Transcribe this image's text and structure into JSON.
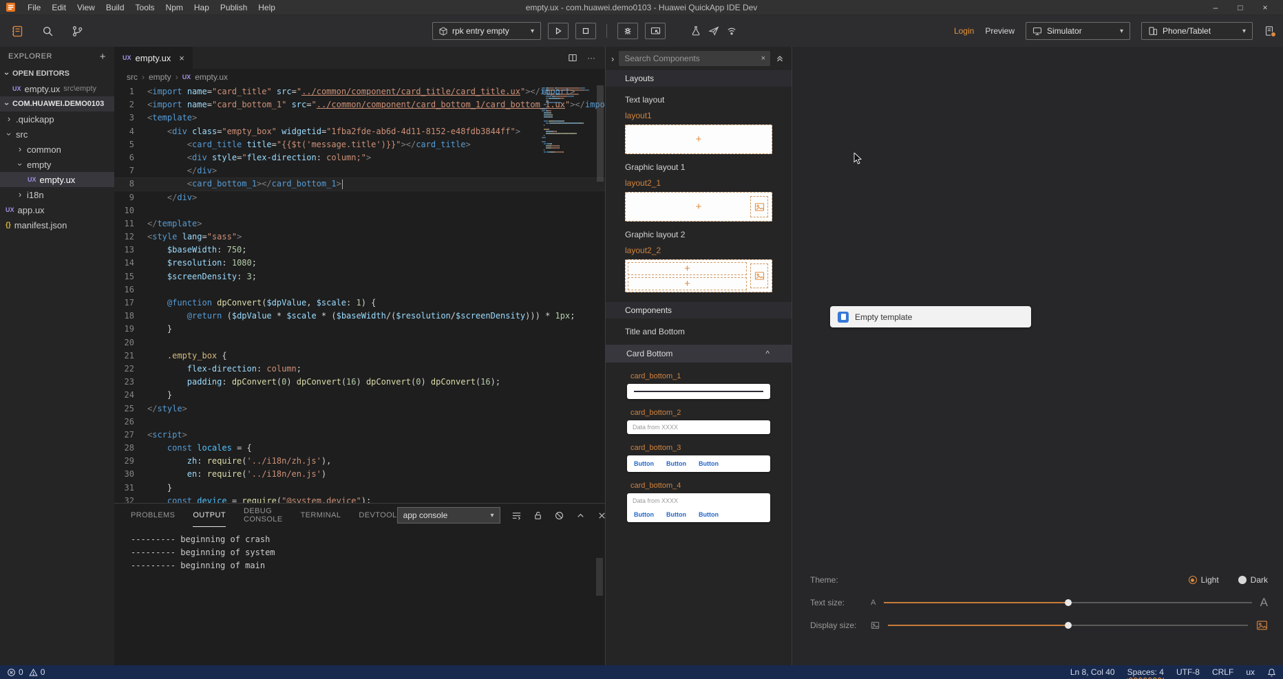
{
  "colors": {
    "accent_orange": "#e08a3c",
    "logo_orange": "#e87722",
    "card_button_blue": "#2468c8",
    "template_icon_blue": "#3678d6",
    "statusbar_navy": "#18294e"
  },
  "glyphs": {
    "plus": "+",
    "close": "×",
    "chevron_right": "›",
    "dropdown_arrow": "▾",
    "caret_up": "^",
    "ellipsis": "···",
    "minimize": "–",
    "maximize": "□",
    "ux_badge": "UX",
    "json_badge": "{}"
  },
  "title_bar": {
    "menus": [
      "File",
      "Edit",
      "View",
      "Build",
      "Tools",
      "Npm",
      "Hap",
      "Publish",
      "Help"
    ],
    "title": "empty.ux - com.huawei.demo0103 - Huawei QuickApp IDE Dev"
  },
  "toolbar": {
    "target_dropdown": "rpk entry empty",
    "login": "Login",
    "preview": "Preview",
    "simulator": "Simulator",
    "device": "Phone/Tablet"
  },
  "explorer": {
    "title": "EXPLORER",
    "open_editors_label": "OPEN EDITORS",
    "open_editor": {
      "badge": "UX",
      "file": "empty.ux",
      "path": "src\\empty"
    },
    "project_label": "COM.HUAWEI.DEMO0103",
    "items": [
      {
        "label": ".quickapp",
        "indent": 1,
        "kind": "folder",
        "expanded": false
      },
      {
        "label": "src",
        "indent": 1,
        "kind": "folder",
        "expanded": true
      },
      {
        "label": "common",
        "indent": 2,
        "kind": "folder",
        "expanded": false
      },
      {
        "label": "empty",
        "indent": 2,
        "kind": "folder",
        "expanded": true
      },
      {
        "label": "empty.ux",
        "indent": 3,
        "kind": "ux",
        "selected": true
      },
      {
        "label": "i18n",
        "indent": 2,
        "kind": "folder",
        "expanded": false
      },
      {
        "label": "app.ux",
        "indent": 1,
        "kind": "ux"
      },
      {
        "label": "manifest.json",
        "indent": 1,
        "kind": "json"
      }
    ]
  },
  "editor": {
    "tab": {
      "badge": "UX",
      "name": "empty.ux"
    },
    "breadcrumb": {
      "root": "src",
      "folder": "empty",
      "badge": "UX",
      "file": "empty.ux"
    },
    "cursor": {
      "line": 8
    },
    "code_lines": [
      [
        [
          "br",
          "<"
        ],
        [
          "tag",
          "import"
        ],
        [
          "pl",
          " "
        ],
        [
          "at",
          "name"
        ],
        [
          "pu",
          "="
        ],
        [
          "st",
          "\"card_title\""
        ],
        [
          "pl",
          " "
        ],
        [
          "at",
          "src"
        ],
        [
          "pu",
          "="
        ],
        [
          "st",
          "\""
        ],
        [
          "sl",
          "../common/component/card_title/card_title.ux"
        ],
        [
          "st",
          "\""
        ],
        [
          "br",
          "></"
        ],
        [
          "tag",
          "import"
        ],
        [
          "br",
          ">"
        ]
      ],
      [
        [
          "br",
          "<"
        ],
        [
          "tag",
          "import"
        ],
        [
          "pl",
          " "
        ],
        [
          "at",
          "name"
        ],
        [
          "pu",
          "="
        ],
        [
          "st",
          "\"card_bottom_1\""
        ],
        [
          "pl",
          " "
        ],
        [
          "at",
          "src"
        ],
        [
          "pu",
          "="
        ],
        [
          "st",
          "\""
        ],
        [
          "sl",
          "../common/component/card_bottom_1/card_bottom_1.ux"
        ],
        [
          "st",
          "\""
        ],
        [
          "br",
          "></"
        ],
        [
          "tag",
          "import"
        ],
        [
          "br",
          ">"
        ]
      ],
      [
        [
          "br",
          "<"
        ],
        [
          "tag",
          "template"
        ],
        [
          "br",
          ">"
        ]
      ],
      [
        [
          "pl",
          "    "
        ],
        [
          "br",
          "<"
        ],
        [
          "tag",
          "div"
        ],
        [
          "pl",
          " "
        ],
        [
          "at",
          "class"
        ],
        [
          "pu",
          "="
        ],
        [
          "st",
          "\"empty_box\""
        ],
        [
          "pl",
          " "
        ],
        [
          "at",
          "widgetid"
        ],
        [
          "pu",
          "="
        ],
        [
          "st",
          "\"1fba2fde-ab6d-4d11-8152-e48fdb3844ff\""
        ],
        [
          "br",
          ">"
        ]
      ],
      [
        [
          "pl",
          "        "
        ],
        [
          "br",
          "<"
        ],
        [
          "tag",
          "card_title"
        ],
        [
          "pl",
          " "
        ],
        [
          "at",
          "title"
        ],
        [
          "pu",
          "="
        ],
        [
          "st",
          "\"{{$t('message.title')}}\""
        ],
        [
          "br",
          "></"
        ],
        [
          "tag",
          "card_title"
        ],
        [
          "br",
          ">"
        ]
      ],
      [
        [
          "pl",
          "        "
        ],
        [
          "br",
          "<"
        ],
        [
          "tag",
          "div"
        ],
        [
          "pl",
          " "
        ],
        [
          "at",
          "style"
        ],
        [
          "pu",
          "="
        ],
        [
          "st",
          "\""
        ],
        [
          "pr",
          "flex-direction"
        ],
        [
          "pu",
          ": "
        ],
        [
          "vl",
          "column;"
        ],
        [
          "st",
          "\""
        ],
        [
          "br",
          ">"
        ]
      ],
      [
        [
          "pl",
          "        "
        ],
        [
          "br",
          "</"
        ],
        [
          "tag",
          "div"
        ],
        [
          "br",
          ">"
        ]
      ],
      [
        [
          "pl",
          "        "
        ],
        [
          "br",
          "<"
        ],
        [
          "tag",
          "card_bottom_1"
        ],
        [
          "br",
          "></"
        ],
        [
          "tag",
          "card_bottom_1"
        ],
        [
          "br",
          ">"
        ]
      ],
      [
        [
          "pl",
          "    "
        ],
        [
          "br",
          "</"
        ],
        [
          "tag",
          "div"
        ],
        [
          "br",
          ">"
        ]
      ],
      [],
      [
        [
          "br",
          "</"
        ],
        [
          "tag",
          "template"
        ],
        [
          "br",
          ">"
        ]
      ],
      [
        [
          "br",
          "<"
        ],
        [
          "tag",
          "style"
        ],
        [
          "pl",
          " "
        ],
        [
          "at",
          "lang"
        ],
        [
          "pu",
          "="
        ],
        [
          "st",
          "\"sass\""
        ],
        [
          "br",
          ">"
        ]
      ],
      [
        [
          "pl",
          "    "
        ],
        [
          "vr",
          "$baseWidth"
        ],
        [
          "pu",
          ": "
        ],
        [
          "nm",
          "750"
        ],
        [
          "pu",
          ";"
        ]
      ],
      [
        [
          "pl",
          "    "
        ],
        [
          "vr",
          "$resolution"
        ],
        [
          "pu",
          ": "
        ],
        [
          "nm",
          "1080"
        ],
        [
          "pu",
          ";"
        ]
      ],
      [
        [
          "pl",
          "    "
        ],
        [
          "vr",
          "$screenDensity"
        ],
        [
          "pu",
          ": "
        ],
        [
          "nm",
          "3"
        ],
        [
          "pu",
          ";"
        ]
      ],
      [],
      [
        [
          "pl",
          "    "
        ],
        [
          "kw",
          "@function"
        ],
        [
          "pl",
          " "
        ],
        [
          "fn",
          "dpConvert"
        ],
        [
          "pu",
          "("
        ],
        [
          "vr",
          "$dpValue"
        ],
        [
          "pu",
          ", "
        ],
        [
          "vr",
          "$scale"
        ],
        [
          "pu",
          ": "
        ],
        [
          "nm",
          "1"
        ],
        [
          "pu",
          ") {"
        ]
      ],
      [
        [
          "pl",
          "        "
        ],
        [
          "kw",
          "@return"
        ],
        [
          "pl",
          " "
        ],
        [
          "pu",
          "("
        ],
        [
          "vr",
          "$dpValue"
        ],
        [
          "pu",
          " * "
        ],
        [
          "vr",
          "$scale"
        ],
        [
          "pu",
          " * ("
        ],
        [
          "vr",
          "$baseWidth"
        ],
        [
          "pu",
          "/("
        ],
        [
          "vr",
          "$resolution"
        ],
        [
          "pu",
          "/"
        ],
        [
          "vr",
          "$screenDensity"
        ],
        [
          "pu",
          "))) * "
        ],
        [
          "nm",
          "1px"
        ],
        [
          "pu",
          ";"
        ]
      ],
      [
        [
          "pl",
          "    "
        ],
        [
          "pu",
          "}"
        ]
      ],
      [],
      [
        [
          "pl",
          "    "
        ],
        [
          "se",
          ".empty_box"
        ],
        [
          "pu",
          " {"
        ]
      ],
      [
        [
          "pl",
          "        "
        ],
        [
          "pr",
          "flex-direction"
        ],
        [
          "pu",
          ": "
        ],
        [
          "vl",
          "column"
        ],
        [
          "pu",
          ";"
        ]
      ],
      [
        [
          "pl",
          "        "
        ],
        [
          "pr",
          "padding"
        ],
        [
          "pu",
          ": "
        ],
        [
          "fn",
          "dpConvert"
        ],
        [
          "pu",
          "("
        ],
        [
          "nm",
          "0"
        ],
        [
          "pu",
          ") "
        ],
        [
          "fn",
          "dpConvert"
        ],
        [
          "pu",
          "("
        ],
        [
          "nm",
          "16"
        ],
        [
          "pu",
          ") "
        ],
        [
          "fn",
          "dpConvert"
        ],
        [
          "pu",
          "("
        ],
        [
          "nm",
          "0"
        ],
        [
          "pu",
          ") "
        ],
        [
          "fn",
          "dpConvert"
        ],
        [
          "pu",
          "("
        ],
        [
          "nm",
          "16"
        ],
        [
          "pu",
          ");"
        ]
      ],
      [
        [
          "pl",
          "    "
        ],
        [
          "pu",
          "}"
        ]
      ],
      [
        [
          "br",
          "</"
        ],
        [
          "tag",
          "style"
        ],
        [
          "br",
          ">"
        ]
      ],
      [],
      [
        [
          "br",
          "<"
        ],
        [
          "tag",
          "script"
        ],
        [
          "br",
          ">"
        ]
      ],
      [
        [
          "pl",
          "    "
        ],
        [
          "kw",
          "const"
        ],
        [
          "pl",
          " "
        ],
        [
          "v2",
          "locales"
        ],
        [
          "pu",
          " = {"
        ]
      ],
      [
        [
          "pl",
          "        "
        ],
        [
          "at",
          "zh"
        ],
        [
          "pu",
          ": "
        ],
        [
          "fn",
          "require"
        ],
        [
          "pu",
          "("
        ],
        [
          "st",
          "'../i18n/zh.js'"
        ],
        [
          "pu",
          "),"
        ]
      ],
      [
        [
          "pl",
          "        "
        ],
        [
          "at",
          "en"
        ],
        [
          "pu",
          ": "
        ],
        [
          "fn",
          "require"
        ],
        [
          "pu",
          "("
        ],
        [
          "st",
          "'../i18n/en.js'"
        ],
        [
          "pu",
          ")"
        ]
      ],
      [
        [
          "pl",
          "    "
        ],
        [
          "pu",
          "}"
        ]
      ],
      [
        [
          "pl",
          "    "
        ],
        [
          "kw",
          "const"
        ],
        [
          "pl",
          " "
        ],
        [
          "v2",
          "device"
        ],
        [
          "pu",
          " = "
        ],
        [
          "fn",
          "require"
        ],
        [
          "pu",
          "("
        ],
        [
          "st",
          "\"@system.device\""
        ],
        [
          "pu",
          ");"
        ]
      ]
    ]
  },
  "bottom_panel": {
    "tabs": [
      "PROBLEMS",
      "OUTPUT",
      "DEBUG CONSOLE",
      "TERMINAL",
      "DEVTOOL"
    ],
    "active_tab": "OUTPUT",
    "channel_dropdown": "app console",
    "output_lines": [
      "--------- beginning of crash",
      "--------- beginning of system",
      "--------- beginning of main"
    ]
  },
  "components_panel": {
    "search_placeholder": "Search Components",
    "layouts_header": "Layouts",
    "groups": [
      {
        "title": "Text layout",
        "item": "layout1"
      },
      {
        "title": "Graphic layout 1",
        "item": "layout2_1"
      },
      {
        "title": "Graphic layout 2",
        "item": "layout2_2"
      }
    ],
    "components_header": "Components",
    "title_and_bottom": "Title and Bottom",
    "card_bottom_header": "Card Bottom",
    "cards": [
      {
        "label": "card_bottom_1"
      },
      {
        "label": "card_bottom_2",
        "text": "Data from XXXX"
      },
      {
        "label": "card_bottom_3",
        "buttons": [
          "Button",
          "Button",
          "Button"
        ]
      },
      {
        "label": "card_bottom_4",
        "text": "Data from XXXX",
        "buttons": [
          "Button",
          "Button",
          "Button"
        ]
      }
    ]
  },
  "preview_panel": {
    "template_card": "Empty template",
    "theme_label": "Theme:",
    "theme_options": [
      "Light",
      "Dark"
    ],
    "theme_selected": "Light",
    "text_size_label": "Text size:",
    "text_size_small": "A",
    "text_size_large": "A",
    "display_size_label": "Display size:"
  },
  "status_bar": {
    "errors": "0",
    "warnings": "0",
    "line_col": "Ln 8, Col 40",
    "indentation": "Spaces: 4",
    "encoding": "UTF-8",
    "eol": "CRLF",
    "language": "ux"
  }
}
